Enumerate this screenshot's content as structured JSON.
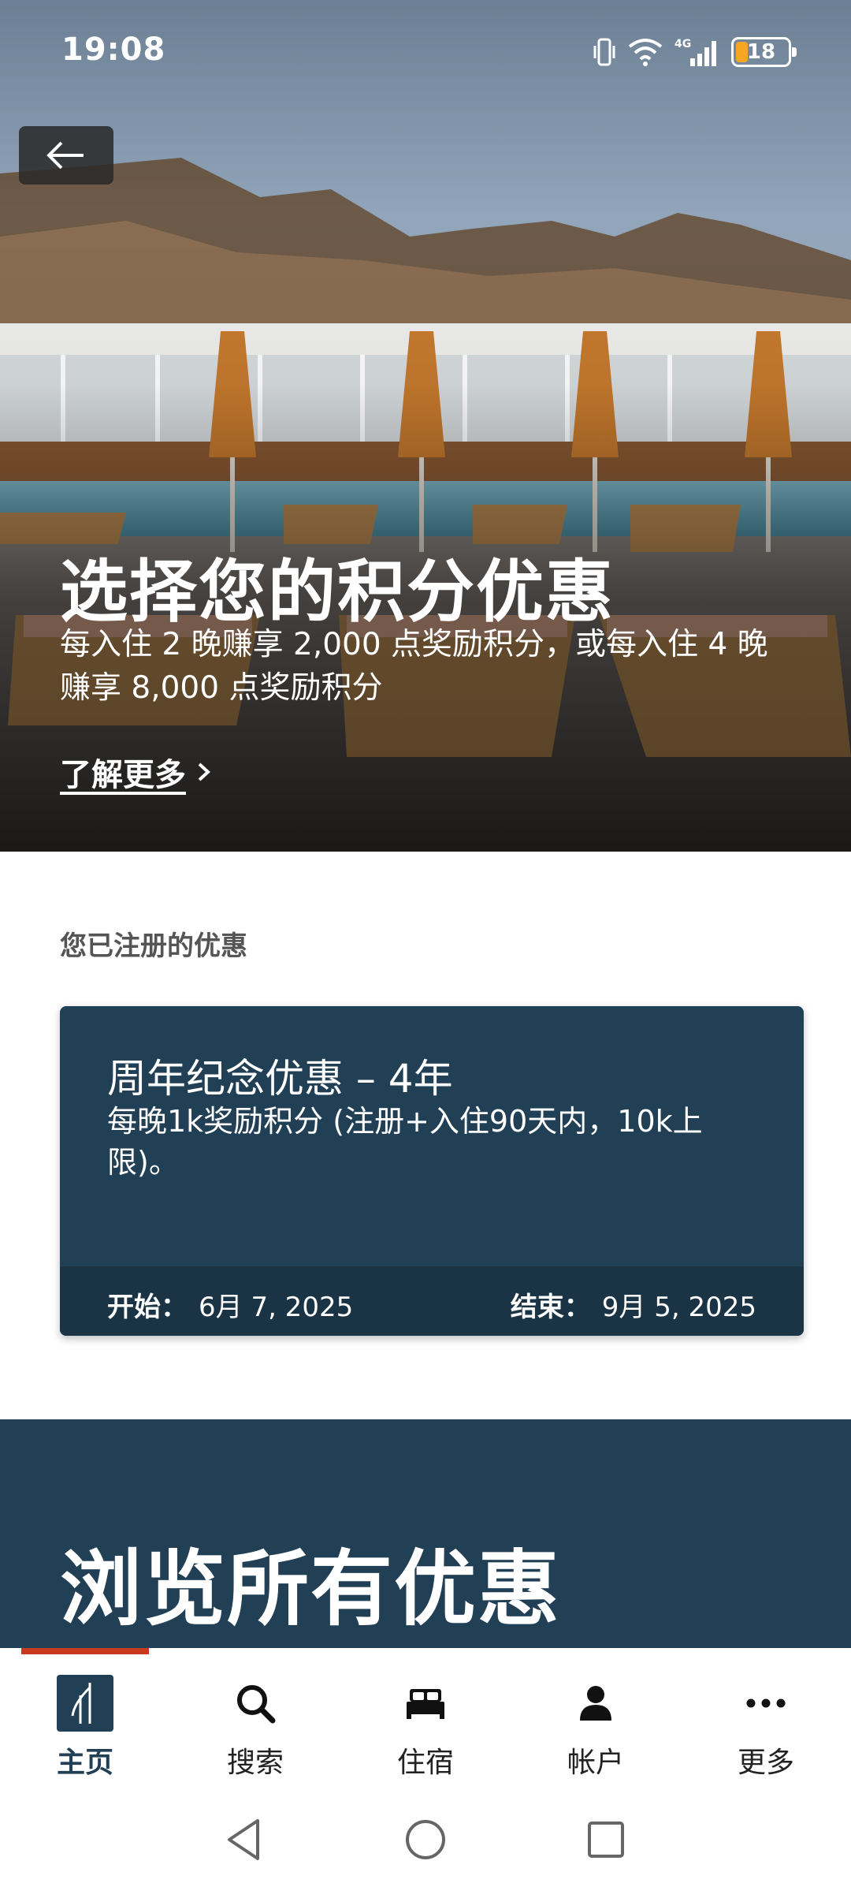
{
  "status_bar": {
    "time": "19:08",
    "battery_level": "18",
    "network": "4G"
  },
  "hero": {
    "title": "选择您的积分优惠",
    "subtitle": "每入住 2 晚赚享 2,000 点奖励积分，或每入住 4 晚赚享 8,000 点奖励积分",
    "link_label": "了解更多"
  },
  "registered": {
    "section_label": "您已注册的优惠",
    "card": {
      "title": "周年纪念优惠 – 4年",
      "description": "每晚1k奖励积分 (注册+入住90天内，10k上限)。",
      "start_label": "开始：",
      "start_date": "6月 7, 2025",
      "end_label": "结束：",
      "end_date": "9月 5, 2025"
    }
  },
  "browse": {
    "title": "浏览所有优惠"
  },
  "bottom_nav": {
    "items": [
      {
        "label": "主页",
        "icon": "home-logo-icon",
        "active": true
      },
      {
        "label": "搜索",
        "icon": "search-icon",
        "active": false
      },
      {
        "label": "住宿",
        "icon": "bed-icon",
        "active": false
      },
      {
        "label": "帐户",
        "icon": "person-icon",
        "active": false
      },
      {
        "label": "更多",
        "icon": "more-dots-icon",
        "active": false
      }
    ]
  },
  "colors": {
    "brand_navy": "#213f55",
    "accent_red": "#c73a1f",
    "battery_orange": "#f5a623"
  }
}
